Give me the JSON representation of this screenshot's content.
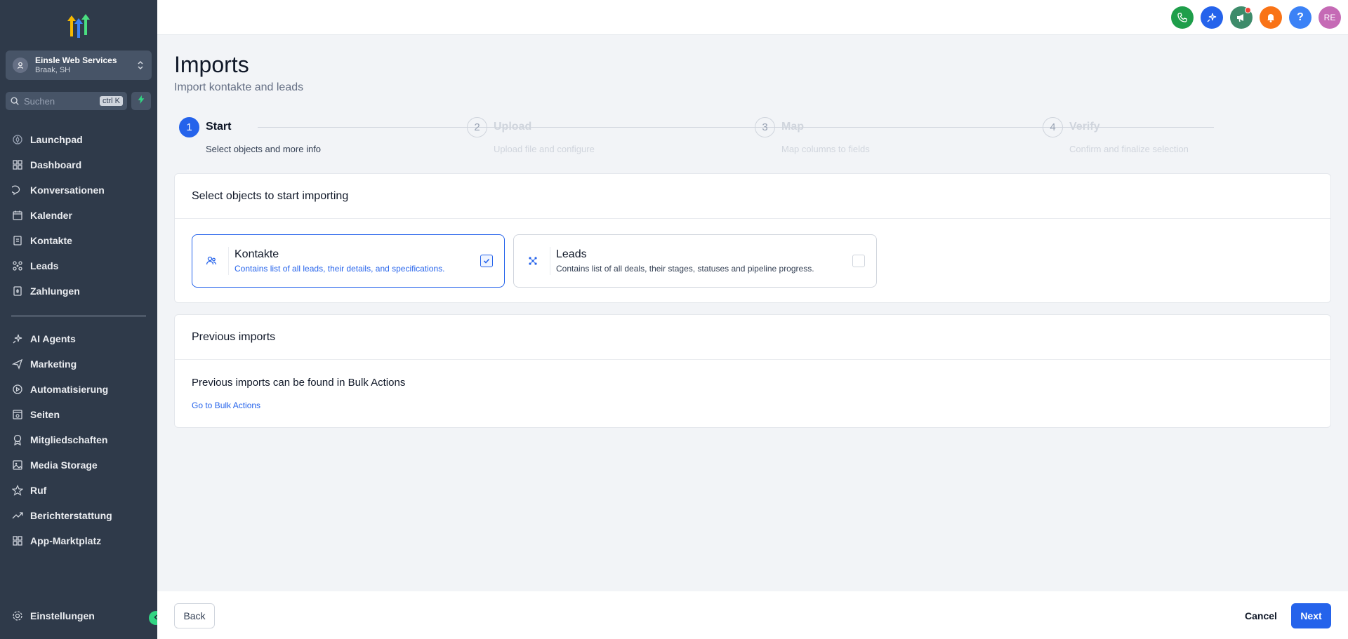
{
  "sidebar": {
    "logo_icon": "brand-logo",
    "account": {
      "name": "Einsle Web Services",
      "location": "Braak, SH"
    },
    "search": {
      "placeholder": "Suchen",
      "shortcut": "ctrl K"
    },
    "nav_primary": [
      {
        "label": "Launchpad",
        "icon": "rocket-icon"
      },
      {
        "label": "Dashboard",
        "icon": "grid-icon"
      },
      {
        "label": "Konversationen",
        "icon": "chat-icon"
      },
      {
        "label": "Kalender",
        "icon": "calendar-icon"
      },
      {
        "label": "Kontakte",
        "icon": "contacts-icon"
      },
      {
        "label": "Leads",
        "icon": "leads-icon"
      },
      {
        "label": "Zahlungen",
        "icon": "payments-icon"
      }
    ],
    "nav_secondary": [
      {
        "label": "AI Agents",
        "icon": "sparkle-icon"
      },
      {
        "label": "Marketing",
        "icon": "send-icon"
      },
      {
        "label": "Automatisierung",
        "icon": "automation-icon"
      },
      {
        "label": "Seiten",
        "icon": "pages-icon"
      },
      {
        "label": "Mitgliedschaften",
        "icon": "award-icon"
      },
      {
        "label": "Media Storage",
        "icon": "image-icon"
      },
      {
        "label": "Ruf",
        "icon": "star-icon"
      },
      {
        "label": "Berichterstattung",
        "icon": "trend-icon"
      },
      {
        "label": "App-Marktplatz",
        "icon": "apps-icon"
      }
    ],
    "settings": {
      "label": "Einstellungen",
      "icon": "gear-icon"
    }
  },
  "topbar": {
    "avatar_initials": "RE",
    "icons": [
      {
        "name": "phone-icon",
        "color": "#1e9e4a"
      },
      {
        "name": "ai-sparkle-icon",
        "color": "#2563eb"
      },
      {
        "name": "megaphone-icon",
        "color": "#3d8b6a"
      },
      {
        "name": "bell-icon",
        "color": "#f97316"
      },
      {
        "name": "help-icon",
        "color": "#3b82f6"
      }
    ],
    "avatar_color": "#c56ab5"
  },
  "page": {
    "title": "Imports",
    "subtitle": "Import kontakte and leads"
  },
  "steps": [
    {
      "number": "1",
      "title": "Start",
      "description": "Select objects and more info",
      "active": true
    },
    {
      "number": "2",
      "title": "Upload",
      "description": "Upload file and configure",
      "active": false
    },
    {
      "number": "3",
      "title": "Map",
      "description": "Map columns to fields",
      "active": false
    },
    {
      "number": "4",
      "title": "Verify",
      "description": "Confirm and finalize selection",
      "active": false
    }
  ],
  "select_objects": {
    "heading": "Select objects to start importing",
    "objects": [
      {
        "title": "Kontakte",
        "description": "Contains list of all leads, their details, and specifications.",
        "selected": true,
        "icon": "contacts-icon"
      },
      {
        "title": "Leads",
        "description": "Contains list of all deals, their stages, statuses and pipeline progress.",
        "selected": false,
        "icon": "leads-icon"
      }
    ]
  },
  "previous_imports": {
    "heading": "Previous imports",
    "text": "Previous imports can be found in Bulk Actions",
    "link": "Go to Bulk Actions"
  },
  "footer": {
    "back_label": "Back",
    "cancel_label": "Cancel",
    "next_label": "Next"
  },
  "colors": {
    "accent": "#2563eb",
    "sidebar_bg": "#2f3a4a"
  }
}
